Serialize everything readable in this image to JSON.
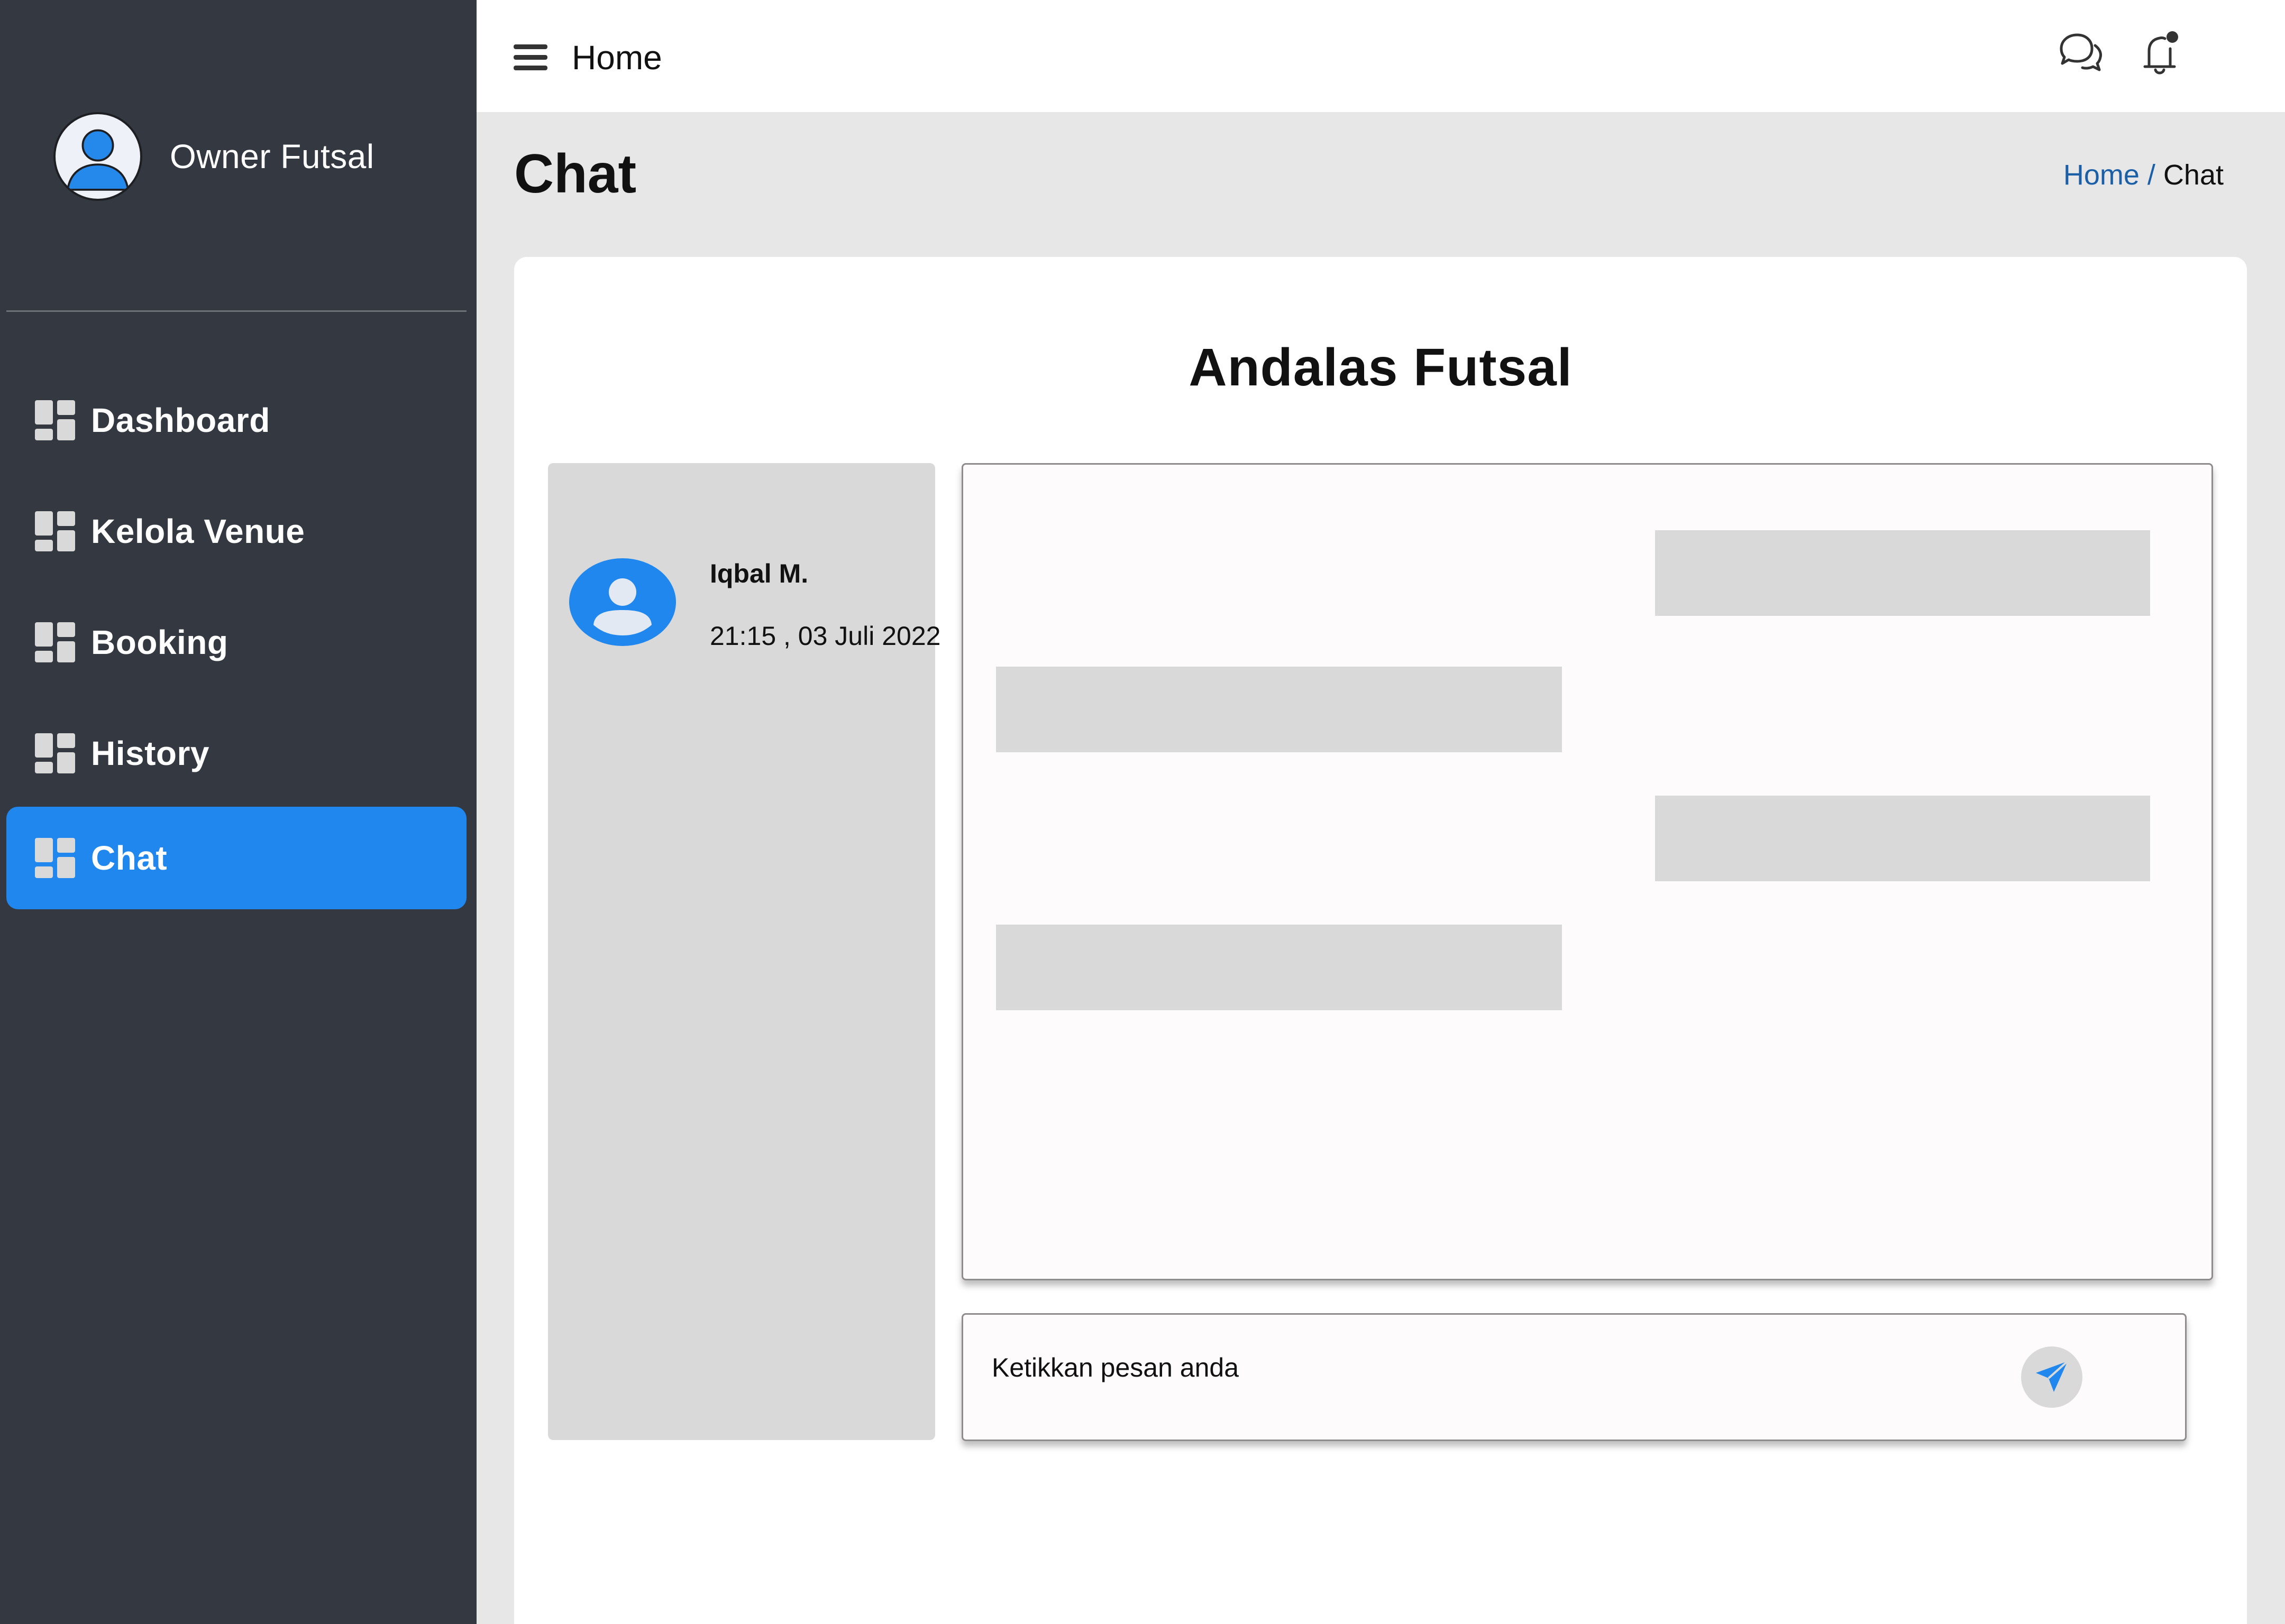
{
  "sidebar": {
    "profile_name": "Owner Futsal",
    "profile_icon": "user-avatar-icon",
    "items": [
      {
        "label": "Dashboard",
        "icon": "dashboard-grid-icon"
      },
      {
        "label": "Kelola Venue",
        "icon": "dashboard-grid-icon"
      },
      {
        "label": "Booking",
        "icon": "dashboard-grid-icon"
      },
      {
        "label": "History",
        "icon": "dashboard-grid-icon"
      },
      {
        "label": "Chat",
        "icon": "dashboard-grid-icon",
        "active": true
      }
    ],
    "active_color": "#1f87ee",
    "background": "#343840"
  },
  "topbar": {
    "title": "Home",
    "icons": [
      "hamburger-menu-icon",
      "chat-bubbles-icon",
      "notification-bell-icon"
    ]
  },
  "page": {
    "title": "Chat",
    "breadcrumb": {
      "home": "Home",
      "separator": "/",
      "current": "Chat"
    }
  },
  "chat": {
    "venue_name": "Andalas Futsal",
    "contacts": [
      {
        "name": "Iqbal M.",
        "time": "21:15 , 03 Juli 2022"
      }
    ],
    "messages": [
      {
        "side": "right"
      },
      {
        "side": "left"
      },
      {
        "side": "right"
      },
      {
        "side": "left"
      }
    ],
    "composer": {
      "placeholder": "Ketikkan pesan anda",
      "send_icon": "send-paper-plane-icon"
    }
  }
}
